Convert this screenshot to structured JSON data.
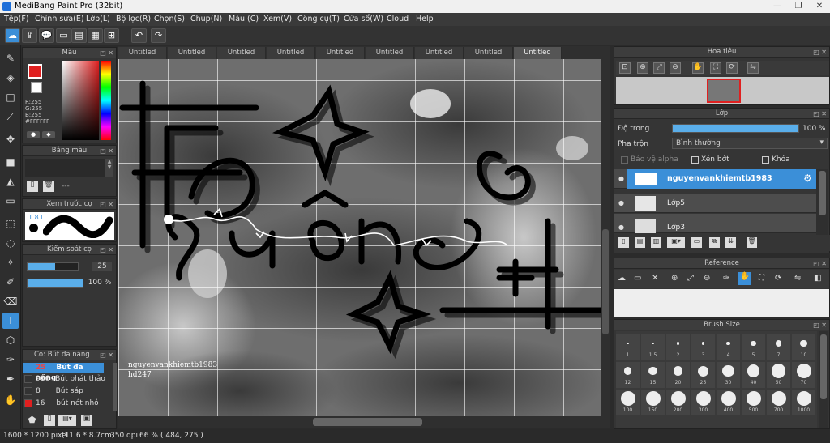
{
  "window": {
    "title": "MediBang Paint Pro (32bit)"
  },
  "menu": [
    "Tệp(F)",
    "Chỉnh sửa(E)",
    "Lớp(L)",
    "Bộ lọc(R)",
    "Chọn(S)",
    "Chụp(N)",
    "Màu (C)",
    "Xem(V)",
    "Công cụ(T)",
    "Cửa sổ(W)",
    "Cloud",
    "Help"
  ],
  "tabs": [
    "Untitled",
    "Untitled",
    "Untitled",
    "Untitled",
    "Untitled",
    "Untitled",
    "Untitled",
    "Untitled",
    "Untitled"
  ],
  "color_panel": {
    "title": "Màu",
    "r": "R:255",
    "g": "G:255",
    "b": "B:255",
    "hex": "#FFFFFF"
  },
  "palette_panel": {
    "title": "Bảng màu",
    "value": "---"
  },
  "brush_preview": {
    "title": "Xem trước cọ",
    "size": "1.8 l"
  },
  "brush_control": {
    "title": "Kiểm soát cọ",
    "size": "25",
    "opacity": "100 %",
    "size_value": 25,
    "opacity_value": 100
  },
  "brush_list": {
    "title": "Cọ: Bút đa năng",
    "items": [
      {
        "size": "25",
        "name": "Bút đa năng",
        "selected": true,
        "color": "#333333"
      },
      {
        "size": "916",
        "name": "Bút phát thảo",
        "selected": false,
        "color": "#333333"
      },
      {
        "size": "8",
        "name": "Bút sáp",
        "selected": false,
        "color": "#333333"
      },
      {
        "size": "16",
        "name": "bút nét nhỏ",
        "selected": false,
        "color": "#e02020"
      }
    ]
  },
  "navigator": {
    "title": "Hoa tiêu"
  },
  "layer_panel": {
    "title": "Lớp",
    "opacity_label": "Độ trong",
    "opacity_value": "100 %",
    "opacity_fraction": 1.0,
    "blend_label": "Pha trộn",
    "blend_value": "Bình thường",
    "protect_alpha": "Bảo vệ alpha",
    "clipping": "Xén bớt",
    "lock": "Khóa",
    "layers": [
      {
        "name": "nguyenvankhiemtb1983",
        "active": true
      },
      {
        "name": "Lớp5",
        "active": false
      },
      {
        "name": "Lớp3",
        "active": false
      }
    ]
  },
  "reference_panel": {
    "title": "Reference"
  },
  "brush_size": {
    "title": "Brush Size",
    "sizes": [
      "1",
      "1.5",
      "2",
      "3",
      "4",
      "5",
      "7",
      "10",
      "12",
      "15",
      "20",
      "25",
      "30",
      "40",
      "50",
      "70",
      "100",
      "150",
      "200",
      "300",
      "400",
      "500",
      "700",
      "1000"
    ]
  },
  "canvas": {
    "watermark_line1": "nguyenvankhiemtb1983",
    "watermark_line2": "hd247"
  },
  "status": {
    "dimensions": "1600 * 1200 pixel",
    "physical": "(11.6 * 8.7cm)",
    "dpi": "350 dpi",
    "zoom": "66 %",
    "coords": "( 484, 275 )"
  },
  "colors": {
    "accent": "#4a9fe0",
    "selected_row": "#3b8fd8"
  }
}
